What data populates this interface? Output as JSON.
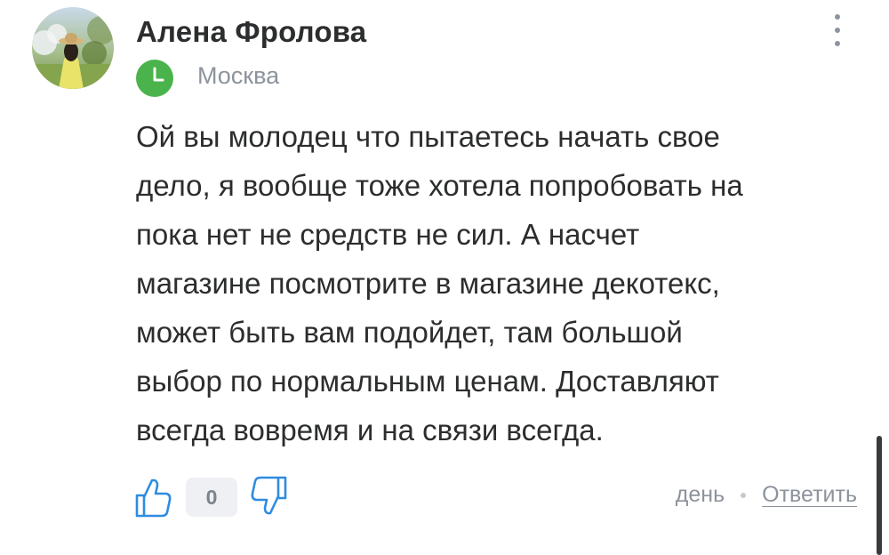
{
  "comment": {
    "author": "Алена Фролова",
    "location": "Москва",
    "badge_icon": "clock-icon",
    "badge_color": "#4bb34b",
    "text_lines": [
      "Ой вы молодец что пытаетесь начать свое",
      "дело, я вообще тоже хотела попробовать на",
      "пока нет не средств не сил. А насчет",
      "магазине посмотрите в магазине декотекс,",
      "может быть вам подойдет, там большой",
      "выбор по нормальным ценам. Доставляют",
      "всегда вовремя и на связи всегда."
    ],
    "likes_count": "0",
    "time": "день",
    "reply_label": "Ответить"
  }
}
